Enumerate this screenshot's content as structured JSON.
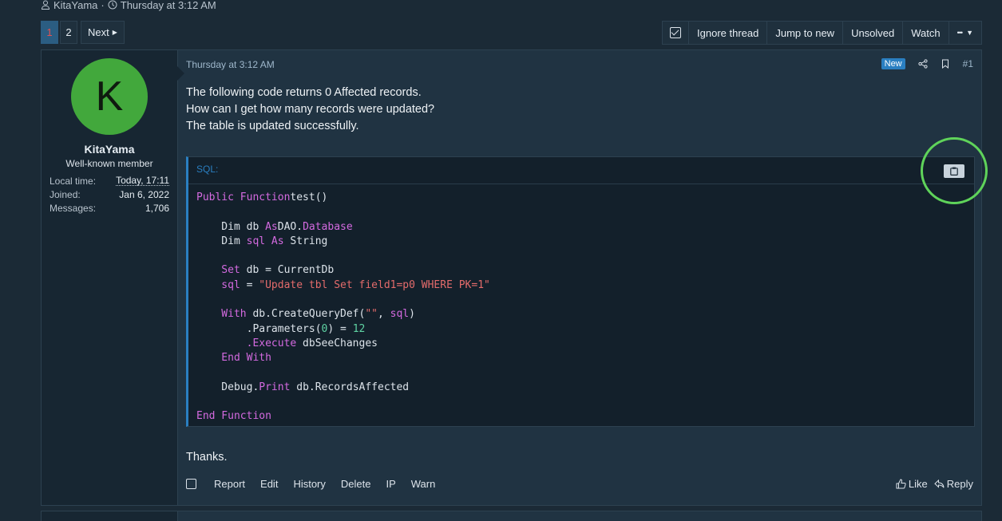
{
  "thread_meta": {
    "author": "KitaYama",
    "separator": "·",
    "date": "Thursday at 3:12 AM"
  },
  "pagination": {
    "pages": [
      "1",
      "2"
    ],
    "current": "1",
    "next_label": "Next"
  },
  "toolbar": {
    "ignore": "Ignore thread",
    "jump": "Jump to new",
    "unsolved": "Unsolved",
    "watch": "Watch",
    "more": "•••"
  },
  "user": {
    "avatar_letter": "K",
    "avatar_color": "#42a83c",
    "name": "KitaYama",
    "title": "Well-known member",
    "stats": [
      {
        "label": "Local time:",
        "value": "Today, 17:11"
      },
      {
        "label": "Joined:",
        "value": "Jan 6, 2022"
      },
      {
        "label": "Messages:",
        "value": "1,706"
      }
    ]
  },
  "post": {
    "date": "Thursday at 3:12 AM",
    "new_badge": "New",
    "number": "#1",
    "lines": [
      "The following code returns 0 Affected records.",
      "How can I get how many records were updated?",
      "The table is updated successfully."
    ],
    "code_title": "SQL:",
    "code": [
      [
        [
          "kw",
          "Public Function"
        ],
        [
          "",
          "test()"
        ]
      ],
      [],
      [
        [
          "",
          "    Dim db "
        ],
        [
          "kw",
          "As"
        ],
        [
          "",
          "DAO."
        ],
        [
          "kw",
          "Database"
        ]
      ],
      [
        [
          "",
          "    Dim "
        ],
        [
          "kw",
          "sql As"
        ],
        [
          "",
          " String"
        ]
      ],
      [],
      [
        [
          "kw",
          "    Set"
        ],
        [
          "",
          " db = CurrentDb"
        ]
      ],
      [
        [
          "kw",
          "    sql"
        ],
        [
          "",
          " = "
        ],
        [
          "str",
          "\"Update tbl Set field1=p0 WHERE PK=1\""
        ]
      ],
      [],
      [
        [
          "kw",
          "    With"
        ],
        [
          "",
          " db.CreateQueryDef("
        ],
        [
          "str",
          "\"\""
        ],
        [
          "",
          ", "
        ],
        [
          "kw",
          "sql"
        ],
        [
          "",
          ")"
        ]
      ],
      [
        [
          "",
          "        .Parameters("
        ],
        [
          "num",
          "0"
        ],
        [
          "",
          ") = "
        ],
        [
          "num",
          "12"
        ]
      ],
      [
        [
          "kw",
          "        .Execute"
        ],
        [
          "",
          " dbSeeChanges"
        ]
      ],
      [
        [
          "kw",
          "    End With"
        ]
      ],
      [],
      [
        [
          "",
          "    Debug."
        ],
        [
          "kw",
          "Print"
        ],
        [
          "",
          " db.RecordsAffected"
        ]
      ],
      [],
      [
        [
          "kw",
          "End Function"
        ]
      ]
    ],
    "closing": "Thanks.",
    "actions_left": [
      "Report",
      "Edit",
      "History",
      "Delete",
      "IP",
      "Warn"
    ],
    "like": "Like",
    "reply": "Reply"
  },
  "accent_color": "#2a7fc1"
}
